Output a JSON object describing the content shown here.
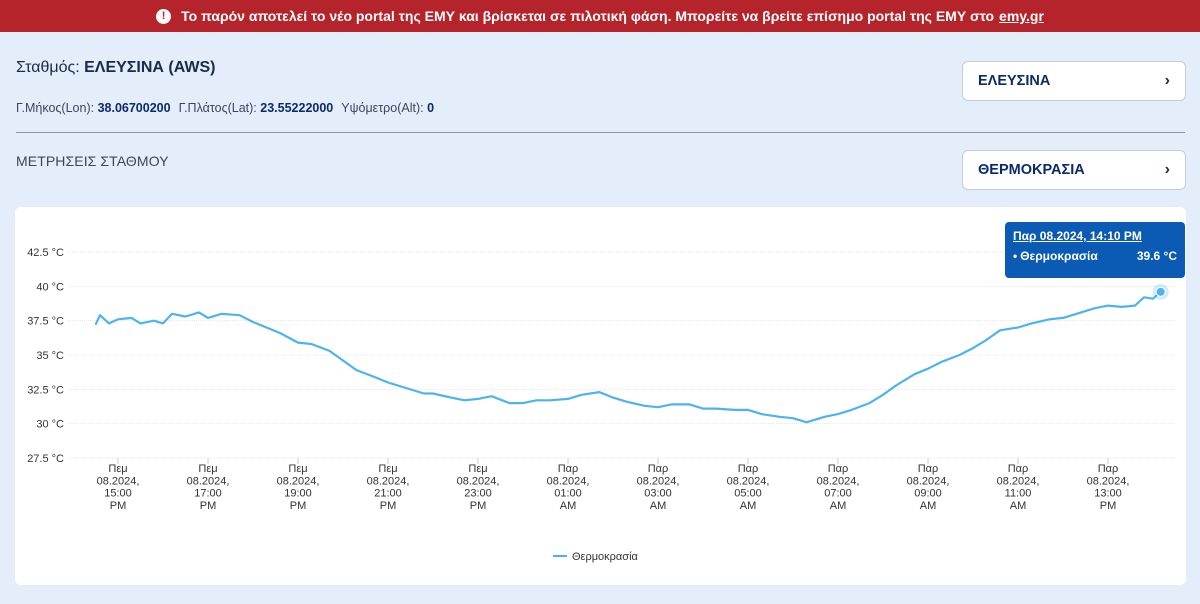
{
  "banner": {
    "icon": "alert-circle-icon",
    "text": "Το παρόν αποτελεί το νέο portal της ΕΜΥ και βρίσκεται σε πιλοτική φάση. Μπορείτε να βρείτε επίσημο portal της ΕΜΥ στο",
    "link_text": "emy.gr"
  },
  "station": {
    "label": "Σταθμός:",
    "name": "ΕΛΕΥΣΙΝΑ (AWS)",
    "lon_label": "Γ.Μήκος(Lon):",
    "lon": "38.06700200",
    "lat_label": "Γ.Πλάτος(Lat):",
    "lat": "23.55222000",
    "alt_label": "Υψόμετρο(Alt):",
    "alt": "0"
  },
  "station_select": {
    "value": "ΕΛΕΥΣΙΝΑ",
    "icon": "chevron-right-icon"
  },
  "section": {
    "title": "ΜΕΤΡΗΣΕΙΣ ΣΤΑΘΜΟΥ"
  },
  "param_select": {
    "value": "ΘΕΡΜΟΚΡΑΣΙΑ",
    "icon": "chevron-right-icon"
  },
  "tooltip": {
    "date": "Παρ 08.2024, 14:10 PM",
    "series": "Θερμοκρασία",
    "value": "39.6 °C"
  },
  "colors": {
    "banner": "#b5232b",
    "line": "#4db3ee",
    "tooltip": "#0b5bb5",
    "accent": "#0b2a6b"
  },
  "chart_data": {
    "type": "line",
    "legend": [
      "Θερμοκρασία"
    ],
    "legend_position": "bottom-center",
    "grid": true,
    "y_unit": "°C",
    "ylim": [
      27.5,
      42.5
    ],
    "y_ticks": [
      {
        "value": 27.5,
        "label": "27.5 °C"
      },
      {
        "value": 30,
        "label": "30 °C"
      },
      {
        "value": 32.5,
        "label": "32.5 °C"
      },
      {
        "value": 35,
        "label": "35 °C"
      },
      {
        "value": 37.5,
        "label": "37.5 °C"
      },
      {
        "value": 40,
        "label": "40 °C"
      },
      {
        "value": 42.5,
        "label": "42.5 °C"
      }
    ],
    "x_ticks": [
      {
        "t": 15,
        "lines": [
          "Πεμ",
          "08.2024,",
          "15:00",
          "PM"
        ]
      },
      {
        "t": 17,
        "lines": [
          "Πεμ",
          "08.2024,",
          "17:00",
          "PM"
        ]
      },
      {
        "t": 19,
        "lines": [
          "Πεμ",
          "08.2024,",
          "19:00",
          "PM"
        ]
      },
      {
        "t": 21,
        "lines": [
          "Πεμ",
          "08.2024,",
          "21:00",
          "PM"
        ]
      },
      {
        "t": 23,
        "lines": [
          "Πεμ",
          "08.2024,",
          "23:00",
          "PM"
        ]
      },
      {
        "t": 25,
        "lines": [
          "Παρ",
          "08.2024,",
          "01:00",
          "AM"
        ]
      },
      {
        "t": 27,
        "lines": [
          "Παρ",
          "08.2024,",
          "03:00",
          "AM"
        ]
      },
      {
        "t": 29,
        "lines": [
          "Παρ",
          "08.2024,",
          "05:00",
          "AM"
        ]
      },
      {
        "t": 31,
        "lines": [
          "Παρ",
          "08.2024,",
          "07:00",
          "AM"
        ]
      },
      {
        "t": 33,
        "lines": [
          "Παρ",
          "08.2024,",
          "09:00",
          "AM"
        ]
      },
      {
        "t": 35,
        "lines": [
          "Παρ",
          "08.2024,",
          "11:00",
          "AM"
        ]
      },
      {
        "t": 37,
        "lines": [
          "Παρ",
          "08.2024,",
          "13:00",
          "PM"
        ]
      }
    ],
    "series": [
      {
        "name": "Θερμοκρασία",
        "x": [
          14.5,
          14.6,
          14.8,
          15.0,
          15.3,
          15.5,
          15.8,
          16.0,
          16.2,
          16.5,
          16.8,
          17.0,
          17.3,
          17.7,
          18.0,
          18.3,
          18.6,
          19.0,
          19.3,
          19.7,
          20.0,
          20.3,
          20.7,
          21.0,
          21.4,
          21.8,
          22.0,
          22.4,
          22.7,
          23.0,
          23.3,
          23.7,
          24.0,
          24.3,
          24.6,
          25.0,
          25.3,
          25.7,
          26.0,
          26.3,
          26.7,
          27.0,
          27.3,
          27.7,
          28.0,
          28.3,
          28.7,
          29.0,
          29.3,
          29.7,
          30.0,
          30.3,
          30.7,
          31.0,
          31.3,
          31.7,
          32.0,
          32.3,
          32.7,
          33.0,
          33.3,
          33.7,
          34.0,
          34.3,
          34.6,
          35.0,
          35.3,
          35.7,
          36.0,
          36.3,
          36.7,
          37.0,
          37.3,
          37.6,
          37.8,
          38.0,
          38.17
        ],
        "y": [
          37.2,
          37.9,
          37.3,
          37.6,
          37.7,
          37.3,
          37.5,
          37.3,
          38.0,
          37.8,
          38.1,
          37.7,
          38.0,
          37.9,
          37.4,
          37.0,
          36.6,
          35.9,
          35.8,
          35.3,
          34.6,
          33.9,
          33.4,
          33.0,
          32.6,
          32.2,
          32.2,
          31.9,
          31.7,
          31.8,
          32.0,
          31.5,
          31.5,
          31.7,
          31.7,
          31.8,
          32.1,
          32.3,
          31.9,
          31.6,
          31.3,
          31.2,
          31.4,
          31.4,
          31.1,
          31.1,
          31.0,
          31.0,
          30.7,
          30.5,
          30.4,
          30.1,
          30.5,
          30.7,
          31.0,
          31.5,
          32.1,
          32.8,
          33.6,
          34.0,
          34.5,
          35.0,
          35.5,
          36.1,
          36.8,
          37.0,
          37.3,
          37.6,
          37.7,
          38.0,
          38.4,
          38.6,
          38.5,
          38.6,
          39.2,
          39.1,
          39.6
        ]
      }
    ]
  }
}
